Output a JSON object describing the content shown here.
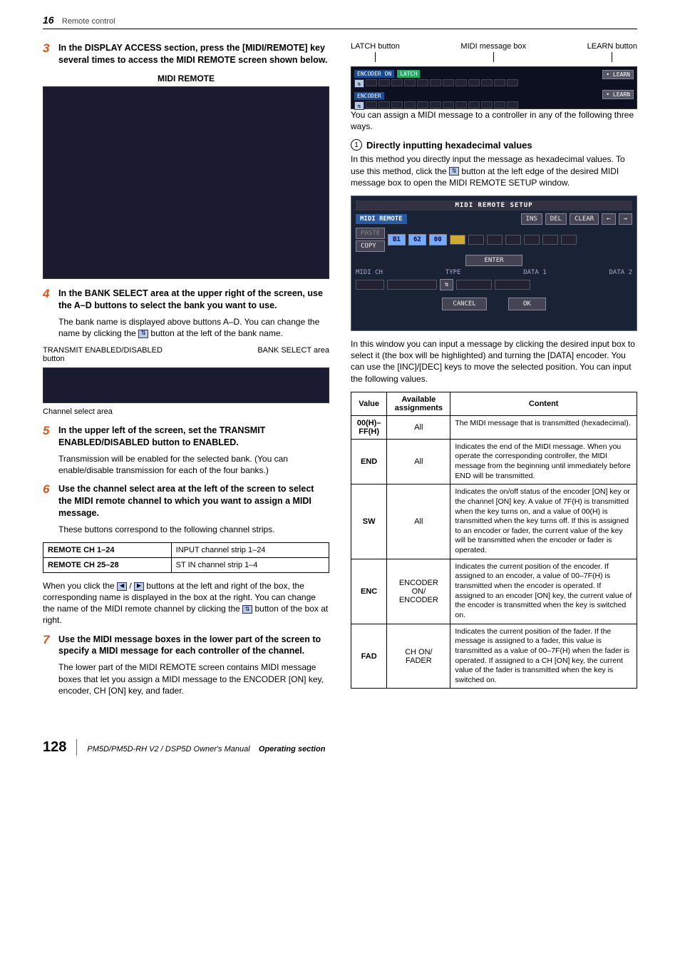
{
  "header": {
    "pageNumTop": "16",
    "sectionLabel": "Remote control"
  },
  "steps": {
    "s3": {
      "num": "3",
      "bold": "In the DISPLAY ACCESS section, press the [MIDI/REMOTE] key several times to access the MIDI REMOTE screen shown below."
    },
    "s4": {
      "num": "4",
      "bold": "In the BANK SELECT area at the upper right of the screen, use the A–D buttons to select the bank you want to use.",
      "body": "The bank name is displayed above buttons A–D. You can change the name by clicking the      button at the left of the bank name."
    },
    "s5": {
      "num": "5",
      "bold": "In the upper left of the screen, set the TRANSMIT ENABLED/DISABLED button to ENABLED.",
      "body": "Transmission will be enabled for the selected bank. (You can enable/disable transmission for each of the four banks.)"
    },
    "s6": {
      "num": "6",
      "bold": "Use the channel select area at the left of the screen to select the MIDI remote channel to which you want to assign a MIDI message.",
      "body": "These buttons correspond to the following channel strips."
    },
    "s7": {
      "num": "7",
      "bold": "Use the MIDI message boxes in the lower part of the screen to specify a MIDI message for each controller of the channel.",
      "body": "The lower part of the MIDI REMOTE screen contains MIDI message boxes that let you assign a MIDI message to the ENCODER [ON] key, encoder, CH [ON] key, and fader."
    }
  },
  "figTitles": {
    "midiRemote": "MIDI REMOTE"
  },
  "callouts2": {
    "left": "TRANSMIT ENABLED/DISABLED button",
    "right": "BANK SELECT area",
    "below": "Channel select area"
  },
  "callouts3": {
    "a": "LATCH button",
    "b": "MIDI message box",
    "c": "LEARN button"
  },
  "remoteTable": {
    "r1c1": "REMOTE CH 1–24",
    "r1c2": "INPUT channel strip 1–24",
    "r2c1": "REMOTE CH 25–28",
    "r2c2": "ST IN channel strip 1–4"
  },
  "afterTable6": "When you click the      /      buttons at the left and right of the box, the corresponding name is displayed in the box at the right. You can change the name of the MIDI remote channel by clicking the      button of the box at right.",
  "rightCol": {
    "intro": "You can assign a MIDI message to a controller in any of the following three ways.",
    "sub1": {
      "num": "1",
      "title": "Directly inputting hexadecimal values",
      "body": "In this method you directly input the message as hexadecimal values. To use this method, click the      button at the left edge of the desired MIDI message box to open the MIDI REMOTE SETUP window."
    },
    "afterSetup": "In this window you can input a message by clicking the desired input box to select it (the box will be highlighted) and turning the [DATA] encoder. You can use the [INC]/[DEC] keys to move the selected position. You can input the following values."
  },
  "midiSetup": {
    "title": "MIDI REMOTE SETUP",
    "label": "MIDI REMOTE",
    "ins": "INS",
    "del": "DEL",
    "clear": "CLEAR",
    "paste": "PASTE",
    "copy": "COPY",
    "b1": "B1",
    "b2": "62",
    "b3": "00",
    "enter": "ENTER",
    "midich": "MIDI CH",
    "type": "TYPE",
    "data1": "DATA 1",
    "data2": "DATA 2",
    "cancel": "CANCEL",
    "ok": "OK"
  },
  "learnBlock": {
    "encOn": "ENCODER ON",
    "enc": "ENCODER",
    "latch": "LATCH",
    "learn": "• LEARN"
  },
  "valTable": {
    "h1": "Value",
    "h2": "Available assignments",
    "h3": "Content",
    "r1v": "00(H)–FF(H)",
    "r1a": "All",
    "r1c": "The MIDI message that is transmitted (hexadecimal).",
    "r2v": "END",
    "r2a": "All",
    "r2c": "Indicates the end of the MIDI message. When you operate the corresponding controller, the MIDI message from the beginning until immediately before END will be transmitted.",
    "r3v": "SW",
    "r3a": "All",
    "r3c": "Indicates the on/off status of the encoder [ON] key or the channel [ON] key. A value of 7F(H) is transmitted when the key turns on, and a value of 00(H) is transmitted when the key turns off. If this is assigned to an encoder or fader, the current value of the key will be transmitted when the encoder or fader is operated.",
    "r4v": "ENC",
    "r4a": "ENCODER ON/ ENCODER",
    "r4c": "Indicates the current position of the encoder. If assigned to an encoder, a value of 00–7F(H) is transmitted when the encoder is operated. If assigned to an encoder [ON] key, the current value of the encoder is transmitted when the key is switched on.",
    "r5v": "FAD",
    "r5a": "CH ON/ FADER",
    "r5c": "Indicates the current position of the fader. If the message is assigned to a fader, this value is transmitted as a value of 00–7F(H) when the fader is operated. If assigned to a CH [ON] key, the current value of the fader is transmitted when the key is switched on."
  },
  "footer": {
    "page": "128",
    "textPlain": "PM5D/PM5D-RH V2 / DSP5D Owner's Manual",
    "textBold": "Operating section"
  }
}
